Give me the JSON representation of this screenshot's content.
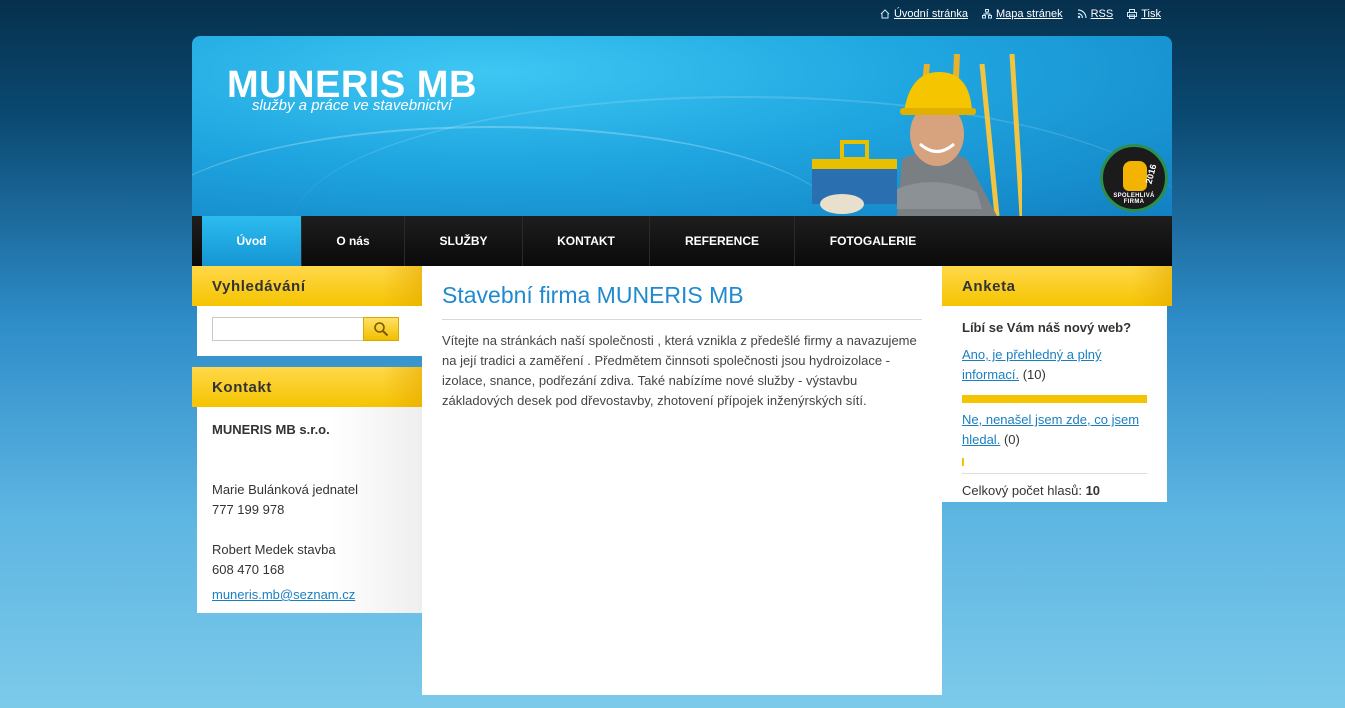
{
  "toplinks": [
    {
      "label": "Úvodní stránka",
      "icon": "home-icon"
    },
    {
      "label": "Mapa stránek",
      "icon": "sitemap-icon"
    },
    {
      "label": "RSS",
      "icon": "rss-icon"
    },
    {
      "label": "Tisk",
      "icon": "print-icon"
    }
  ],
  "header": {
    "title": "MUNERIS MB",
    "slogan": "služby a práce ve stavebnictví",
    "badge": {
      "text": "SPOLEHLIVÁ FIRMA",
      "year": "2016"
    }
  },
  "nav": {
    "items": [
      {
        "label": "Úvod",
        "active": true
      },
      {
        "label": "O nás",
        "active": false
      },
      {
        "label": "SLUŽBY",
        "active": false
      },
      {
        "label": "KONTAKT",
        "active": false
      },
      {
        "label": "REFERENCE",
        "active": false
      },
      {
        "label": "FOTOGALERIE",
        "active": false
      }
    ]
  },
  "search": {
    "heading": "Vyhledávání",
    "value": "",
    "placeholder": ""
  },
  "contact": {
    "heading": "Kontakt",
    "company": "MUNERIS MB s.r.o.",
    "person1_name": "Marie Bulánková jednatel",
    "person1_phone": "777 199 978",
    "person2_name": "Robert Medek stavba",
    "person2_phone": "608 470 168",
    "email": "muneris.mb@seznam.cz"
  },
  "main": {
    "title": "Stavební firma MUNERIS MB",
    "text": "Vítejte na stránkách naší společnosti , která vznikla z předešlé firmy  a navazujeme na její tradici a zaměření . Předmětem činnsoti společnosti jsou hydroizolace - izolace, snance, podřezání zdiva. Také nabízíme nové služby - výstavbu základových desek pod dřevostavby, zhotovení přípojek inženýrských sítí."
  },
  "poll": {
    "heading": "Anketa",
    "question": "Líbí se Vám náš nový web?",
    "options": [
      {
        "label": "Ano, je přehledný a plný informací.",
        "count": "(10)",
        "fraction": 1.0
      },
      {
        "label": "Ne, nenašel jsem zde, co jsem hledal.",
        "count": "(0)",
        "fraction": 0.0
      }
    ],
    "total_label": "Celkový počet hlasů:",
    "total_value": "10"
  },
  "colors": {
    "accent_blue": "#1f8ad0",
    "accent_yellow": "#f5c400",
    "nav_bg": "#0a0a0a"
  }
}
